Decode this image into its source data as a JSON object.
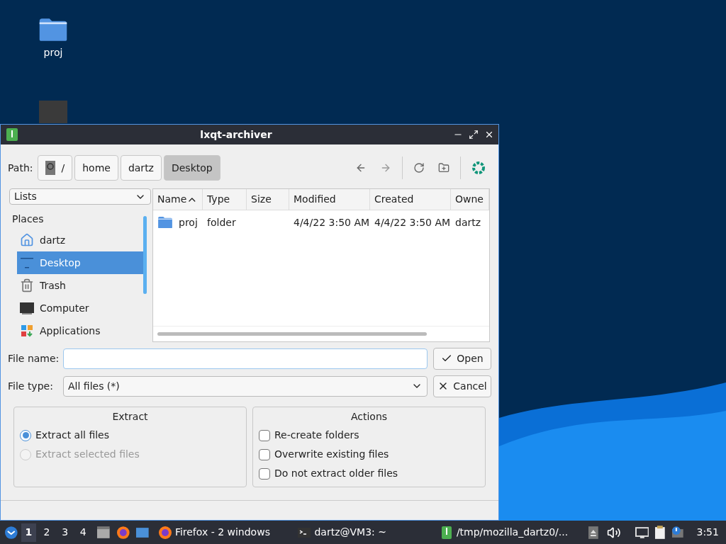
{
  "desktop_icons": [
    {
      "kind": "folder",
      "label": "proj"
    },
    {
      "kind": "monitor"
    }
  ],
  "window": {
    "title": "lxqt-archiver",
    "path_label": "Path:",
    "crumbs": [
      {
        "label": "/",
        "kind": "root",
        "selected": false
      },
      {
        "label": "home",
        "kind": "dir",
        "selected": false
      },
      {
        "label": "dartz",
        "kind": "dir",
        "selected": false
      },
      {
        "label": "Desktop",
        "kind": "dir",
        "selected": true
      }
    ],
    "view_select": "Lists",
    "places_header": "Places",
    "places": [
      {
        "label": "dartz",
        "kind": "home",
        "selected": false
      },
      {
        "label": "Desktop",
        "kind": "desktop",
        "selected": true
      },
      {
        "label": "Trash",
        "kind": "trash",
        "selected": false
      },
      {
        "label": "Computer",
        "kind": "computer",
        "selected": false
      },
      {
        "label": "Applications",
        "kind": "apps",
        "selected": false
      }
    ],
    "columns": [
      "Name",
      "Type",
      "Size",
      "Modified",
      "Created",
      "Owne"
    ],
    "rows": [
      {
        "name": "proj",
        "type": "folder",
        "size_text": "",
        "modified": "4/4/22 3:50 AM",
        "created": "4/4/22 3:50 AM",
        "owner": "dartz"
      }
    ],
    "file_name_label": "File name:",
    "file_type_label": "File type:",
    "file_type": "All files (*)",
    "open_button": "Open",
    "cancel_button": "Cancel",
    "extract": {
      "title": "Extract",
      "options": [
        {
          "label": "Extract all files",
          "selected": true,
          "disabled": false
        },
        {
          "label": "Extract selected files",
          "selected": false,
          "disabled": true
        }
      ]
    },
    "actions": {
      "title": "Actions",
      "options": [
        {
          "label": "Re-create folders",
          "checked": false
        },
        {
          "label": "Overwrite existing files",
          "checked": false
        },
        {
          "label": "Do not extract older files",
          "checked": false
        }
      ]
    }
  },
  "taskbar": {
    "workspaces": [
      {
        "label": "1",
        "selected": true
      },
      {
        "label": "2",
        "selected": false
      },
      {
        "label": "3",
        "selected": false
      },
      {
        "label": "4",
        "selected": false
      }
    ],
    "tasks": [
      {
        "label": "Firefox - 2 windows",
        "kind": "firefox"
      },
      {
        "label": "dartz@VM3: ~",
        "kind": "terminal"
      },
      {
        "label": "/tmp/mozilla_dartz0/...",
        "kind": "archive"
      }
    ],
    "clock": "3:51"
  }
}
